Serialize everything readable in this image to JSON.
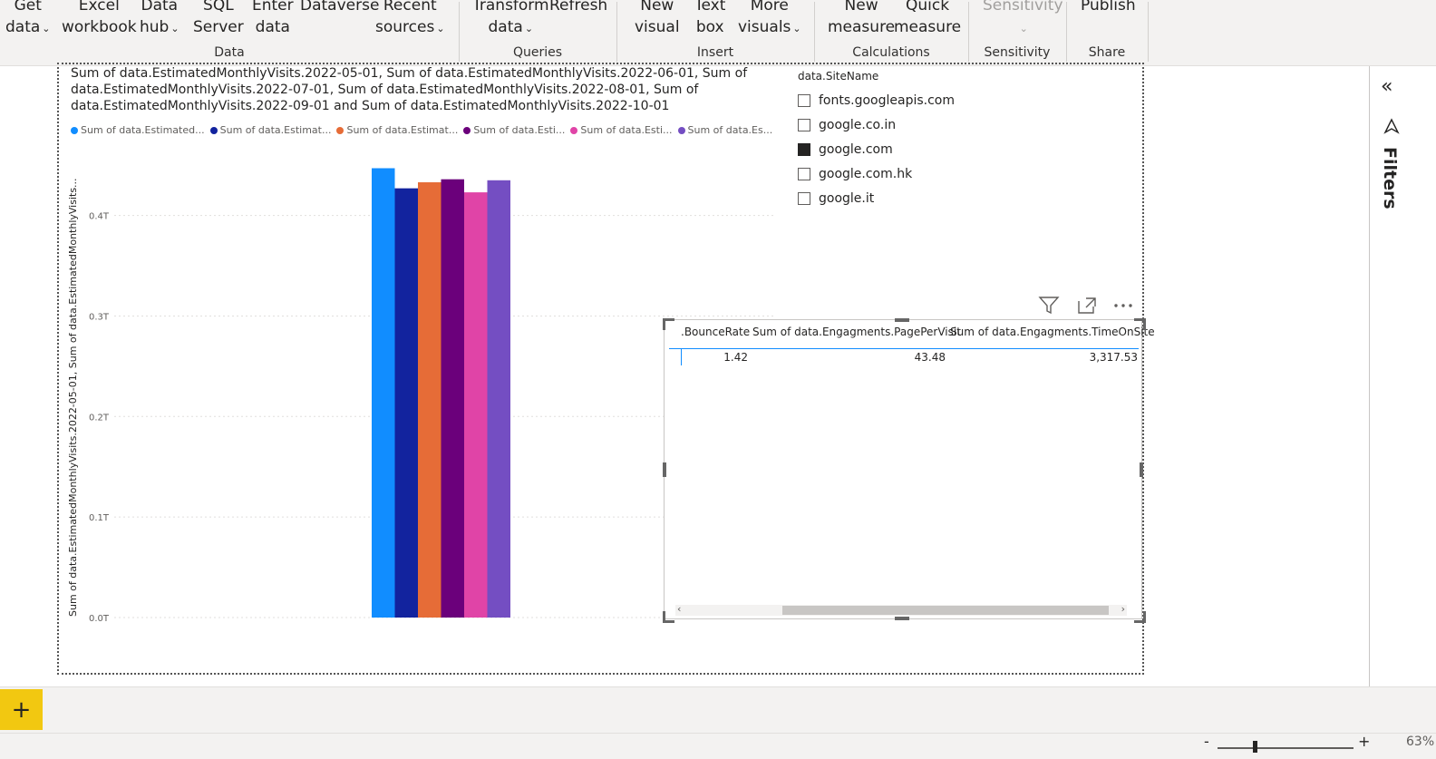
{
  "ribbon": {
    "get_data": [
      "Get",
      "data"
    ],
    "excel_workbook": [
      "Excel",
      "workbook"
    ],
    "data_hub": [
      "Data",
      "hub"
    ],
    "sql_server": [
      "SQL",
      "Server"
    ],
    "enter_data": [
      "Enter",
      "data"
    ],
    "dataverse": "Dataverse",
    "recent_sources": [
      "Recent",
      "sources"
    ],
    "transform_data": [
      "Transform",
      "data"
    ],
    "refresh": "Refresh",
    "new_visual": [
      "New",
      "visual"
    ],
    "text_box": [
      "Text",
      "box"
    ],
    "more_visuals": [
      "More",
      "visuals"
    ],
    "new_measure": [
      "New",
      "measure"
    ],
    "quick_measure": [
      "Quick",
      "measure"
    ],
    "sensitivity": "Sensitivity",
    "publish": "Publish",
    "groups": {
      "data": "Data",
      "queries": "Queries",
      "insert": "Insert",
      "calculations": "Calculations",
      "sensitivity": "Sensitivity",
      "share": "Share"
    }
  },
  "chart": {
    "title": "Sum of data.EstimatedMonthlyVisits.2022-05-01, Sum of data.EstimatedMonthlyVisits.2022-06-01, Sum of data.EstimatedMonthlyVisits.2022-07-01, Sum of data.EstimatedMonthlyVisits.2022-08-01, Sum of data.EstimatedMonthlyVisits.2022-09-01 and Sum of data.EstimatedMonthlyVisits.2022-10-01",
    "ylabel": "Sum of data.EstimatedMonthlyVisits.2022-05-01, Sum of data.EstimatedMonthlyVisits..."
  },
  "chart_data": {
    "type": "bar",
    "categories": [
      ""
    ],
    "series": [
      {
        "name": "Sum of data.Estimated...",
        "values": [
          0.447
        ],
        "color": "#118dff"
      },
      {
        "name": "Sum of data.Estimat...",
        "values": [
          0.427
        ],
        "color": "#12239e"
      },
      {
        "name": "Sum of data.Estimat...",
        "values": [
          0.433
        ],
        "color": "#e66c37"
      },
      {
        "name": "Sum of data.Esti...",
        "values": [
          0.436
        ],
        "color": "#6b007b"
      },
      {
        "name": "Sum of data.Esti...",
        "values": [
          0.423
        ],
        "color": "#e044a7"
      },
      {
        "name": "Sum of data.Es...",
        "values": [
          0.435
        ],
        "color": "#744ec2"
      }
    ],
    "yticks": [
      "0.0T",
      "0.1T",
      "0.2T",
      "0.3T",
      "0.4T"
    ],
    "ylim": [
      0,
      0.47
    ],
    "grid": true,
    "legend": "top-left"
  },
  "slicer": {
    "title": "data.SiteName",
    "items": [
      {
        "label": "fonts.googleapis.com",
        "checked": false
      },
      {
        "label": "google.co.in",
        "checked": false
      },
      {
        "label": "google.com",
        "checked": true
      },
      {
        "label": "google.com.hk",
        "checked": false
      },
      {
        "label": "google.it",
        "checked": false
      }
    ]
  },
  "table": {
    "headers": [
      ".BounceRate",
      "Sum of data.Engagments.PagePerVisit",
      "Sum of data.Engagments.TimeOnSite"
    ],
    "rows": [
      [
        "1.42",
        "43.48",
        "3,317.53"
      ]
    ]
  },
  "filters_label": "Filters",
  "add_page": "+",
  "zoom": {
    "minus": "-",
    "plus": "+",
    "percent": "63%",
    "level": 0.63
  }
}
